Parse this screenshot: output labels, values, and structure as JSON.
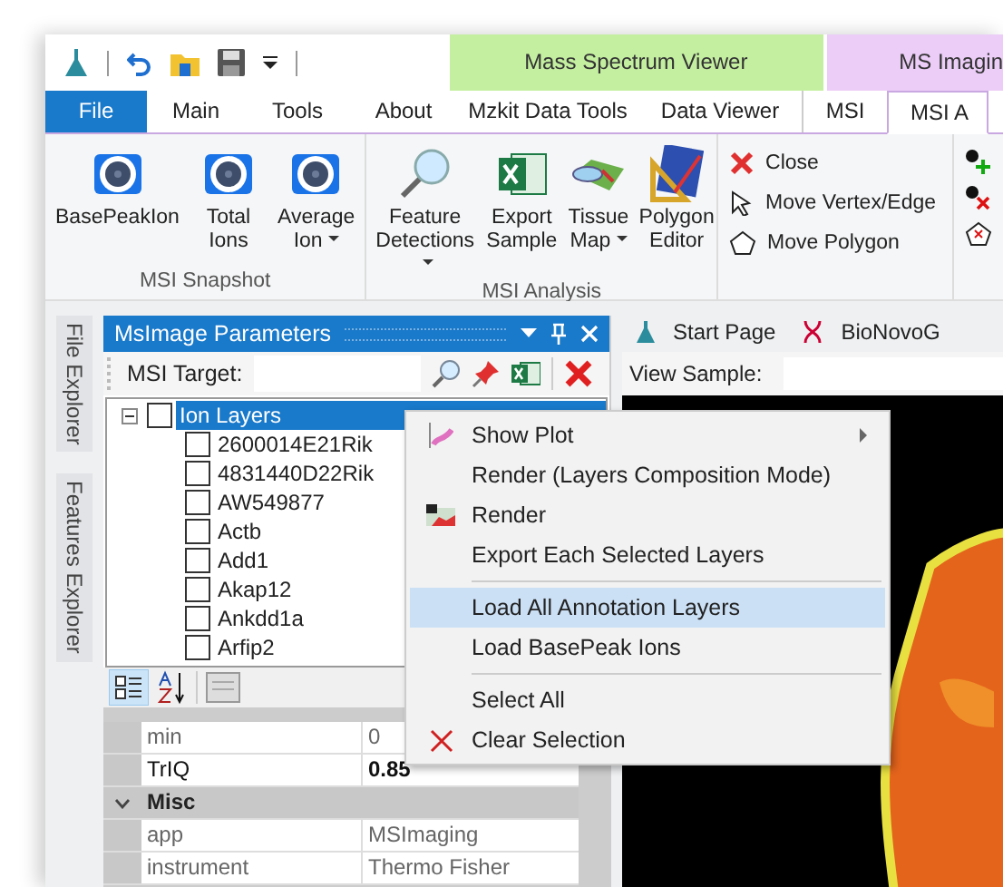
{
  "context_tab_groups": [
    {
      "label": "Mass Spectrum Viewer",
      "color": "#c4efa0"
    },
    {
      "label": "MS Imagin",
      "color": "#ebcdf7"
    }
  ],
  "tabs": [
    {
      "label": "File",
      "kind": "file",
      "selected": false
    },
    {
      "label": "Main",
      "kind": "tab",
      "selected": false
    },
    {
      "label": "Tools",
      "kind": "tab",
      "selected": false
    },
    {
      "label": "About",
      "kind": "tab",
      "selected": false
    },
    {
      "label": "Mzkit Data Tools",
      "kind": "tab",
      "selected": false
    },
    {
      "label": "Data Viewer",
      "kind": "tab",
      "selected": false
    },
    {
      "label": "MSI",
      "kind": "tab",
      "selected": false
    },
    {
      "label": "MSI A",
      "kind": "tab",
      "selected": true
    }
  ],
  "ribbon_groups": [
    {
      "title": "MSI Snapshot",
      "kind": "large",
      "buttons": [
        {
          "label": "BasePeakIon",
          "dropdown": false
        },
        {
          "label": "Total Ions",
          "dropdown": false
        },
        {
          "label": "Average Ion",
          "dropdown": true
        }
      ]
    },
    {
      "title": "MSI Analysis",
      "kind": "large",
      "buttons": [
        {
          "label": "Feature Detections",
          "dropdown": true
        },
        {
          "label": "Export Sample",
          "dropdown": false
        },
        {
          "label": "Tissue Map",
          "dropdown": true
        },
        {
          "label": "Polygon Editor",
          "dropdown": false
        }
      ]
    },
    {
      "kind": "small",
      "buttons": [
        {
          "label": "Close"
        },
        {
          "label": "Move Vertex/Edge"
        },
        {
          "label": "Move Polygon"
        }
      ]
    }
  ],
  "side_tabs": [
    "File Explorer",
    "Features Explorer"
  ],
  "panel": {
    "title": "MsImage Parameters",
    "target_label": "MSI Target:",
    "tree": {
      "label": "Ion Layers",
      "checked": false,
      "selected": true,
      "expanded": true,
      "children": [
        {
          "label": "2600014E21Rik",
          "checked": false
        },
        {
          "label": "4831440D22Rik",
          "checked": false
        },
        {
          "label": "AW549877",
          "checked": false
        },
        {
          "label": "Actb",
          "checked": false
        },
        {
          "label": "Add1",
          "checked": false
        },
        {
          "label": "Akap12",
          "checked": false
        },
        {
          "label": "Ankdd1a",
          "checked": false
        },
        {
          "label": "Arfip2",
          "checked": false
        }
      ]
    },
    "grid_rows": [
      {
        "kind": "property",
        "name": "min",
        "value": "0",
        "modified": false
      },
      {
        "kind": "property",
        "name": "TrIQ",
        "value": "0.85",
        "modified": true
      },
      {
        "kind": "category",
        "name": "Misc",
        "expanded": true
      },
      {
        "kind": "property",
        "name": "app",
        "value": "MSImaging",
        "modified": false
      },
      {
        "kind": "property",
        "name": "instrument",
        "value": "Thermo Fisher",
        "modified": false
      }
    ]
  },
  "doc_tabs": [
    "Start Page",
    "BioNovoG"
  ],
  "view_sample_label": "View Sample:",
  "context_menu": [
    {
      "kind": "item",
      "label": "Show Plot",
      "submenu": true,
      "selected": false
    },
    {
      "kind": "item",
      "label": "Render (Layers Composition Mode)",
      "submenu": false,
      "selected": false
    },
    {
      "kind": "item",
      "label": "Render",
      "submenu": false,
      "selected": false
    },
    {
      "kind": "item",
      "label": "Export Each Selected Layers",
      "submenu": false,
      "selected": false
    },
    {
      "kind": "separator"
    },
    {
      "kind": "item",
      "label": "Load All Annotation Layers",
      "submenu": false,
      "selected": true
    },
    {
      "kind": "item",
      "label": "Load BasePeak Ions",
      "submenu": false,
      "selected": false
    },
    {
      "kind": "separator"
    },
    {
      "kind": "item",
      "label": "Select All",
      "submenu": false,
      "selected": false
    },
    {
      "kind": "item",
      "label": "Clear Selection",
      "submenu": false,
      "selected": false
    }
  ]
}
